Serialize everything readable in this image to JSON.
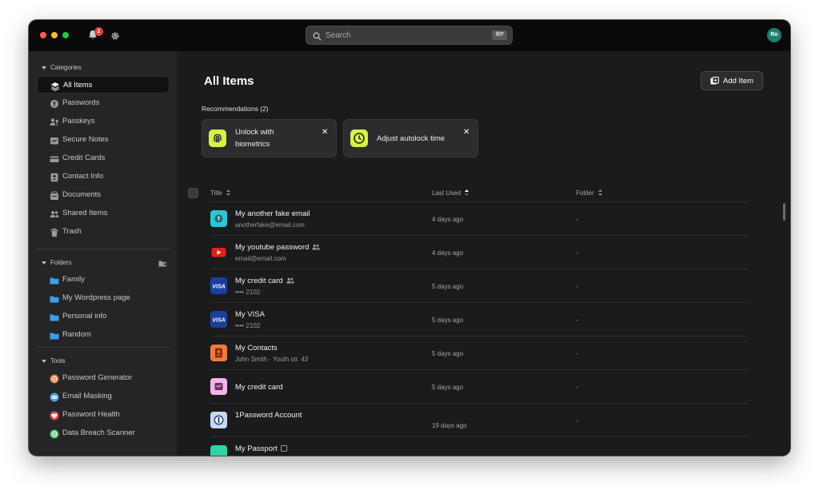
{
  "titlebar": {
    "notification_count": "2",
    "search_placeholder": "Search",
    "search_shortcut": "⌘F",
    "avatar_initials": "Ro"
  },
  "sidebar": {
    "categories_label": "Categories",
    "categories": [
      {
        "label": "All Items",
        "icon": "layers-icon"
      },
      {
        "label": "Passwords",
        "icon": "key-icon"
      },
      {
        "label": "Passkeys",
        "icon": "passkey-icon"
      },
      {
        "label": "Secure Notes",
        "icon": "note-icon"
      },
      {
        "label": "Credit Cards",
        "icon": "credit-card-icon"
      },
      {
        "label": "Contact Info",
        "icon": "contact-icon"
      },
      {
        "label": "Documents",
        "icon": "document-icon"
      },
      {
        "label": "Shared Items",
        "icon": "users-icon"
      },
      {
        "label": "Trash",
        "icon": "trash-icon"
      }
    ],
    "folders_label": "Folders",
    "folders": [
      {
        "label": "Family"
      },
      {
        "label": "My Wordpress page"
      },
      {
        "label": "Personal info"
      },
      {
        "label": "Random"
      }
    ],
    "tools_label": "Tools",
    "tools": [
      {
        "label": "Password Generator",
        "icon": "generator-icon",
        "color": "#e8772e"
      },
      {
        "label": "Email Masking",
        "icon": "mask-icon",
        "color": "#4aa3e8"
      },
      {
        "label": "Password Health",
        "icon": "heart-icon",
        "color": "#e84a4a"
      },
      {
        "label": "Data Breach Scanner",
        "icon": "radar-icon",
        "color": "#3ec45a"
      }
    ]
  },
  "main": {
    "title": "All Items",
    "add_item_label": "Add Item",
    "recommendations_label": "Recommendations (2)",
    "recommendations": [
      {
        "line1": "Unlock with",
        "line2": "biometrics",
        "icon": "fingerprint-icon"
      },
      {
        "line1": "Adjust autolock time",
        "icon": "clock-icon"
      }
    ],
    "columns": {
      "title": "Title",
      "last_used": "Last Used",
      "folder": "Folder"
    },
    "rows": [
      {
        "title": "My another fake email",
        "subtitle": "anotherfake@email.com",
        "last_used": "4 days ago",
        "folder": "-",
        "icon": "key-icon",
        "icon_bg": "#2fc4d4",
        "shared": false
      },
      {
        "title": "My youtube password",
        "subtitle": "email@email.com",
        "last_used": "4 days ago",
        "folder": "-",
        "icon": "youtube-icon",
        "icon_bg": "#e62117",
        "shared": true
      },
      {
        "title": "My credit card",
        "subtitle": "•••• 2102",
        "last_used": "5 days ago",
        "folder": "-",
        "icon": "visa-icon",
        "icon_bg": "#1a3f9e",
        "shared": true
      },
      {
        "title": "My VISA",
        "subtitle": "•••• 2102",
        "last_used": "5 days ago",
        "folder": "-",
        "icon": "visa-icon",
        "icon_bg": "#1a3f9e",
        "shared": false
      },
      {
        "title": "My Contacts",
        "subtitle": "John Smith · Youth str. 43",
        "last_used": "5 days ago",
        "folder": "-",
        "icon": "contact-icon",
        "icon_bg": "#f07a3a",
        "shared": false
      },
      {
        "title": "My credit card",
        "subtitle": "",
        "last_used": "5 days ago",
        "folder": "-",
        "icon": "note-icon",
        "icon_bg": "#f4b4e8",
        "shared": false
      },
      {
        "title": "1Password Account",
        "subtitle": "",
        "last_used": "19 days ago",
        "folder": "-",
        "icon": "onepassword-icon",
        "icon_bg": "#c9d8ec",
        "shared": false
      },
      {
        "title": "My Passport",
        "subtitle": "",
        "last_used": "",
        "folder": "",
        "icon": "passport-icon",
        "icon_bg": "#2fd4a4",
        "shared": false
      }
    ]
  }
}
